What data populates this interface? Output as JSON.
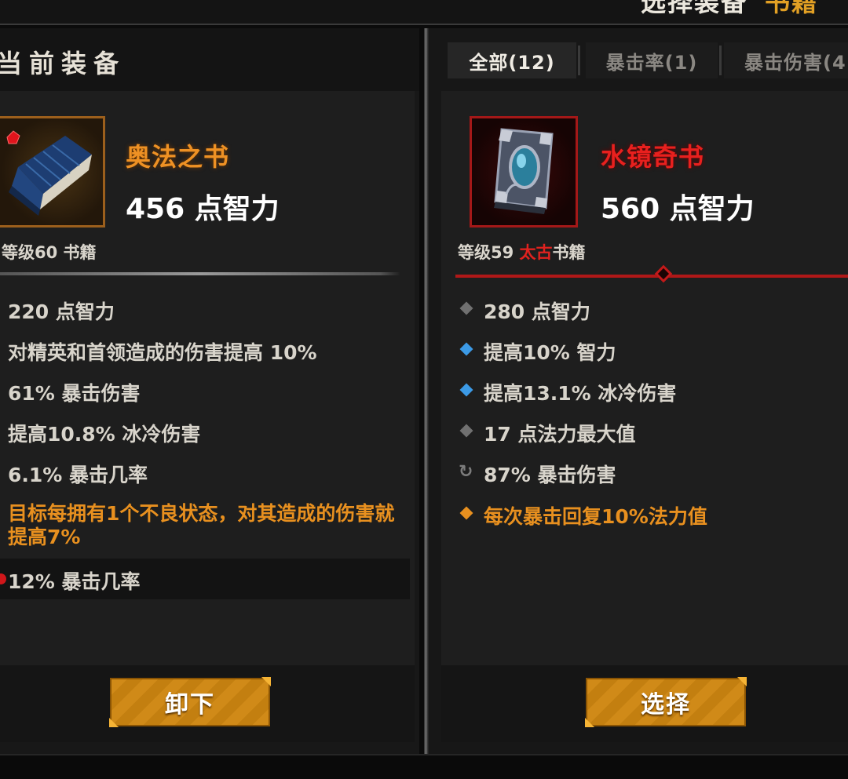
{
  "header": {
    "title": "选择装备",
    "subtitle": "书籍"
  },
  "current": {
    "title": "当前装备",
    "item": {
      "name": "奥法之书",
      "primary_stat": "456 点智力",
      "type_prefix": "等级60 书籍",
      "rarity_color": "#ee9124"
    },
    "affixes": [
      "220 点智力",
      "对精英和首领造成的伤害提高 10%",
      "61% 暴击伤害",
      "提高10.8% 冰冷伤害",
      "6.1% 暴击几率"
    ],
    "legendary_affix": "目标每拥有1个不良状态，对其造成的伤害就提高7%",
    "socket": "12% 暴击几率",
    "button": "卸下"
  },
  "tabs": [
    {
      "label": "全部(12)",
      "active": true
    },
    {
      "label": "暴击率(1)",
      "active": false
    },
    {
      "label": "暴击伤害(4",
      "active": false
    }
  ],
  "candidate": {
    "item": {
      "name": "水镜奇书",
      "primary_stat": "560 点智力",
      "type_level": "等级59 ",
      "type_quality": "太古",
      "type_kind": "书籍",
      "rarity_color": "#e8201e"
    },
    "affixes": [
      {
        "icon": "gray-diamond",
        "text": "280 点智力"
      },
      {
        "icon": "blue-diamond",
        "text": "提高10% 智力"
      },
      {
        "icon": "blue-diamond",
        "text": "提高13.1% 冰冷伤害"
      },
      {
        "icon": "gray-diamond",
        "text": "17 点法力最大值"
      },
      {
        "icon": "reroll",
        "text": "87% 暴击伤害"
      },
      {
        "icon": "orange-diamond",
        "text": "每次暴击回复10%法力值"
      }
    ],
    "button": "选择"
  }
}
